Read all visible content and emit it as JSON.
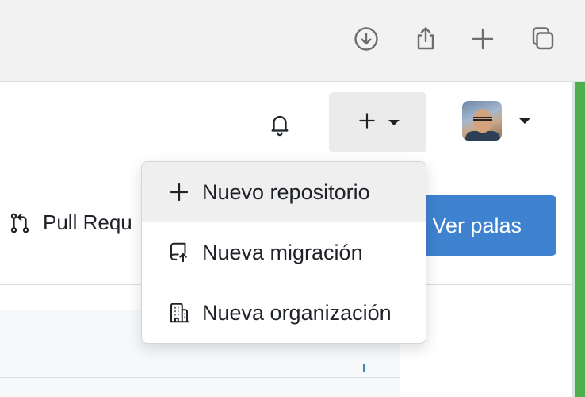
{
  "browser": {
    "buttons": [
      {
        "name": "downloads-icon"
      },
      {
        "name": "share-icon"
      },
      {
        "name": "new-tab-icon"
      },
      {
        "name": "tab-overview-icon"
      }
    ]
  },
  "header": {
    "notifications_icon": "bell-icon",
    "create_icon": "plus-icon",
    "avatar_alt": "user avatar"
  },
  "subbar": {
    "pull_requests_label": "Pull Requ",
    "boards_button_label": "Ver palas",
    "boards_button_color": "#3f82d0"
  },
  "dropdown": {
    "items": [
      {
        "label": "Nuevo repositorio",
        "icon": "plus-icon"
      },
      {
        "label": "Nueva migración",
        "icon": "repo-push-icon"
      },
      {
        "label": "Nueva organización",
        "icon": "organization-icon"
      }
    ]
  },
  "colors": {
    "accent": "#3f82d0",
    "edge": "#4cae4c"
  }
}
